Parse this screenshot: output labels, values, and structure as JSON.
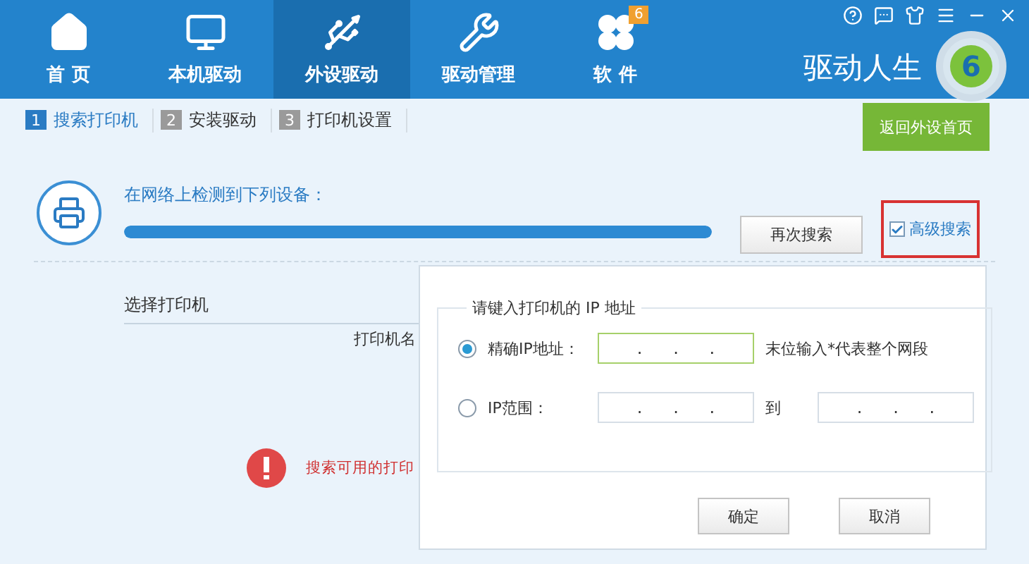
{
  "nav": [
    {
      "label": "首 页",
      "kind": "home",
      "selected": false
    },
    {
      "label": "本机驱动",
      "kind": "monitor",
      "selected": false
    },
    {
      "label": "外设驱动",
      "kind": "usb",
      "selected": true
    },
    {
      "label": "驱动管理",
      "kind": "tools",
      "selected": false
    },
    {
      "label": "软 件",
      "kind": "apps",
      "selected": false,
      "badge": "6"
    }
  ],
  "brand": {
    "name": "驱动人生",
    "logo_digit": "6"
  },
  "steps": [
    {
      "number": "1",
      "label": "搜索打印机",
      "selected": true
    },
    {
      "number": "2",
      "label": "安装驱动",
      "selected": false
    },
    {
      "number": "3",
      "label": "打印机设置",
      "selected": false
    }
  ],
  "back_button": "返回外设首页",
  "scan": {
    "message": "在网络上检测到下列设备：",
    "level": 1,
    "rescan_button": "再次搜索",
    "advanced": {
      "label": "高级搜索",
      "checked": true
    }
  },
  "select_title": "选择打印机",
  "column_1": "打印机名",
  "error": "搜索可用的打印",
  "dialog": {
    "legend": "请键入打印机的 IP 地址",
    "options": [
      {
        "label": "精确IP地址：",
        "selected": true,
        "fields": [
          {
            "dots": [
              ".",
              ".",
              "."
            ]
          }
        ],
        "hint": "末位输入*代表整个网段"
      },
      {
        "label": "IP范围：",
        "selected": false,
        "fields": [
          {
            "dots": [
              ".",
              ".",
              "."
            ]
          },
          {
            "dots": [
              ".",
              ".",
              "."
            ]
          }
        ],
        "joiner": "到"
      }
    ],
    "buttons": [
      "确定",
      "取消"
    ]
  }
}
